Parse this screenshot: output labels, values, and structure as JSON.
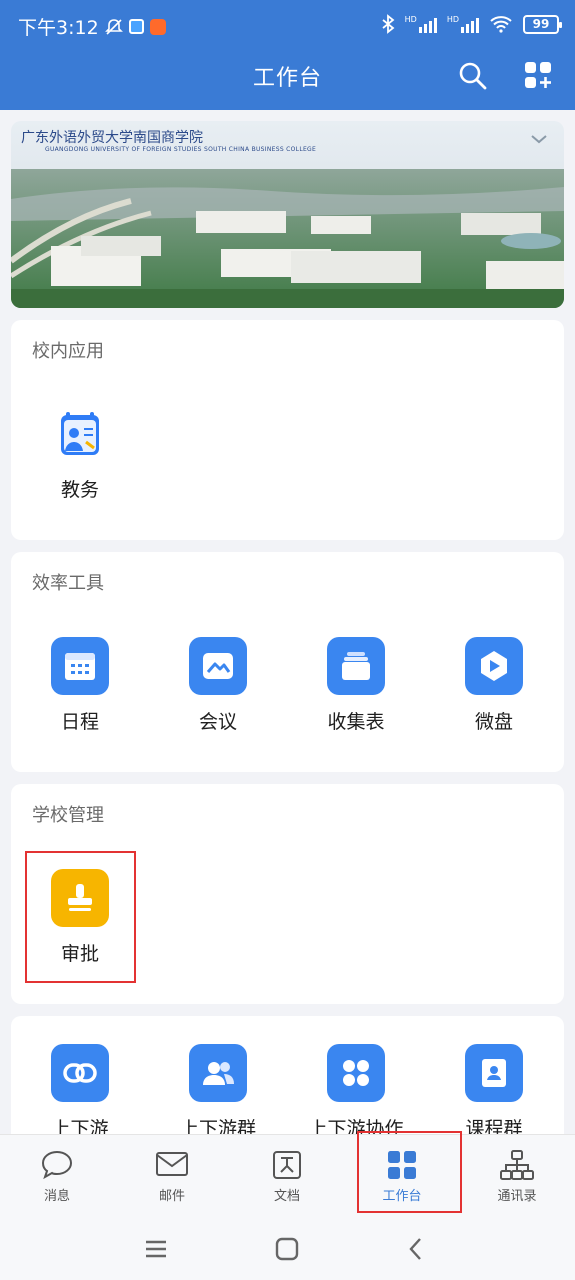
{
  "status_bar": {
    "time": "下午3:12",
    "battery": "99",
    "net1": "HD",
    "net2": "HD"
  },
  "header": {
    "title": "工作台"
  },
  "banner": {
    "school_name": "广东外语外贸大学南国商学院",
    "school_sub": "GUANGDONG UNIVERSITY OF FOREIGN STUDIES SOUTH CHINA BUSINESS COLLEGE"
  },
  "sections": {
    "campus": {
      "title": "校内应用",
      "apps": [
        {
          "label": "教务"
        }
      ]
    },
    "efficiency": {
      "title": "效率工具",
      "apps": [
        {
          "label": "日程"
        },
        {
          "label": "会议"
        },
        {
          "label": "收集表"
        },
        {
          "label": "微盘"
        }
      ]
    },
    "school": {
      "title": "学校管理",
      "apps": [
        {
          "label": "审批"
        }
      ]
    },
    "partners": {
      "apps": [
        {
          "label": "上下游"
        },
        {
          "label": "上下游群"
        },
        {
          "label": "上下游协作"
        },
        {
          "label": "课程群"
        }
      ]
    }
  },
  "tabs": [
    {
      "label": "消息",
      "icon": "message-icon"
    },
    {
      "label": "邮件",
      "icon": "mail-icon"
    },
    {
      "label": "文档",
      "icon": "doc-icon"
    },
    {
      "label": "工作台",
      "icon": "workbench-icon"
    },
    {
      "label": "通讯录",
      "icon": "contacts-icon"
    }
  ],
  "colors": {
    "primary": "#3a7bd5",
    "app_blue": "#3a86f0",
    "approval": "#f7b500",
    "highlight": "#e33232"
  }
}
